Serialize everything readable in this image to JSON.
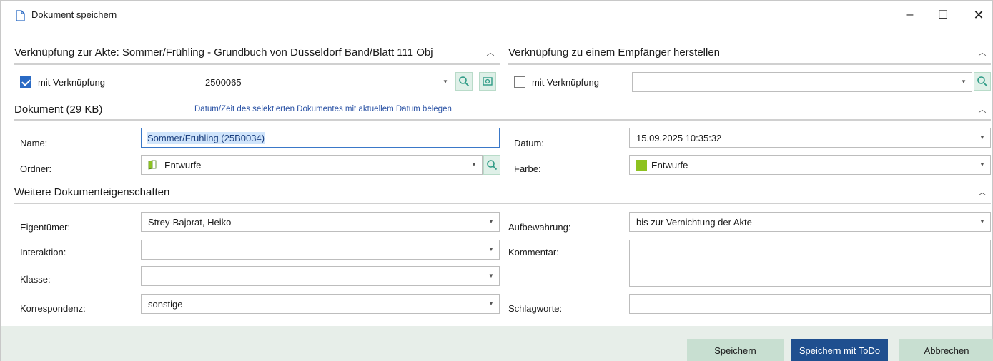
{
  "window": {
    "title": "Dokument speichern",
    "minimize": "–",
    "maximize": "☐",
    "close": "✕"
  },
  "akte_section": {
    "title": "Verknüpfung zur Akte: Sommer/Frühling - Grundbuch von Düsseldorf Band/Blatt 111 Obj",
    "checkbox_label": "mit Verknüpfung",
    "checked": true,
    "akte_value": "2500065"
  },
  "empfaenger_section": {
    "title": "Verknüpfung zu einem Empfänger herstellen",
    "checkbox_label": "mit Verknüpfung",
    "checked": false,
    "value": ""
  },
  "dokument_section": {
    "title": "Dokument (29 KB)",
    "date_link": "Datum/Zeit des selektierten Dokumentes mit aktuellem Datum belegen",
    "name_label": "Name:",
    "name_value": "Sommer/Fruhling (25B0034)",
    "datum_label": "Datum:",
    "datum_value": "15.09.2025 10:35:32",
    "ordner_label": "Ordner:",
    "ordner_value": "Entwurfe",
    "farbe_label": "Farbe:",
    "farbe_value": "Entwurfe",
    "farbe_color": "#8dc21f"
  },
  "weitere_section": {
    "title": "Weitere Dokumenteigenschaften",
    "eigentuemer_label": "Eigentümer:",
    "eigentuemer_value": "Strey-Bajorat, Heiko",
    "aufbewahrung_label": "Aufbewahrung:",
    "aufbewahrung_value": "bis zur Vernichtung der Akte",
    "interaktion_label": "Interaktion:",
    "interaktion_value": "",
    "kommentar_label": "Kommentar:",
    "kommentar_value": "",
    "klasse_label": "Klasse:",
    "klasse_value": "",
    "korrespondenz_label": "Korrespondenz:",
    "korrespondenz_value": "sonstige",
    "schlagworte_label": "Schlagworte:",
    "schlagworte_value": ""
  },
  "buttons": {
    "save": "Speichern",
    "save_todo": "Speichern mit ToDo",
    "cancel": "Abbrechen"
  },
  "colors": {
    "primary_button": "#1f4f8f",
    "secondary_button": "#c8dfd1",
    "footer_bg": "#e7eee9",
    "checkbox_accent": "#2a6ac4"
  }
}
